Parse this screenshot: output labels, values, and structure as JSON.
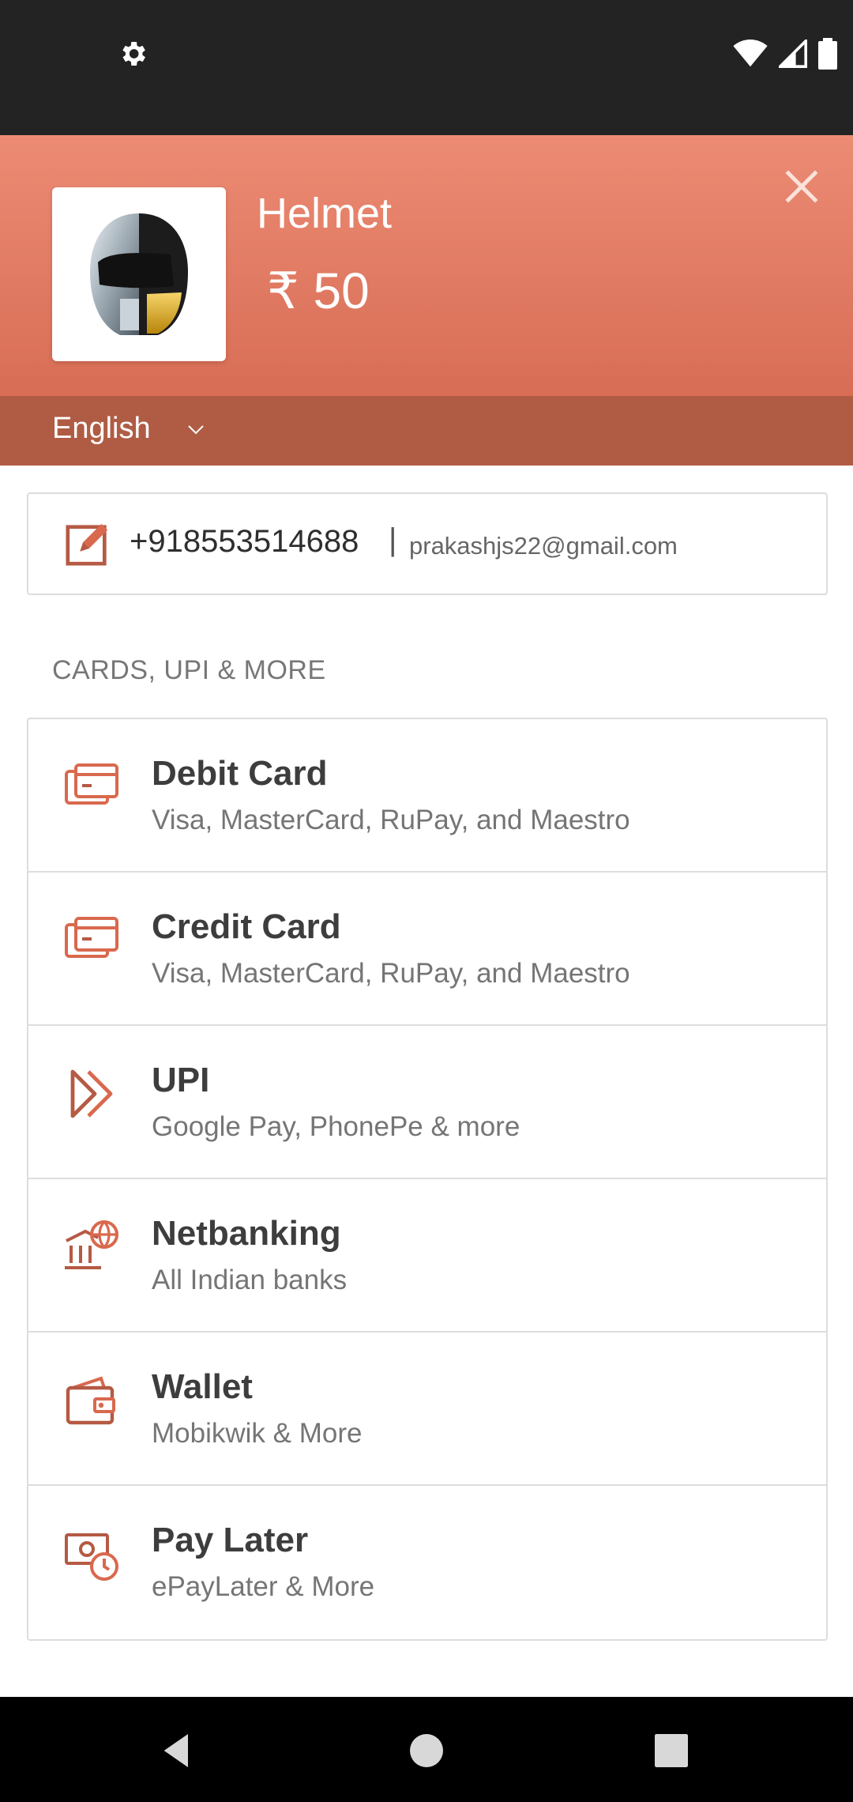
{
  "status_bar": {
    "left_icon": "gear-icon",
    "right_icons": [
      "wifi-icon",
      "signal-icon",
      "battery-icon"
    ]
  },
  "header": {
    "product_name": "Helmet",
    "price": "₹ 50",
    "close_icon": "close-icon",
    "product_image": "helmet-image"
  },
  "language": {
    "selected": "English",
    "icon": "chevron-down-icon"
  },
  "contact": {
    "phone": "+918553514688",
    "separator": "|",
    "email": "prakashjs22@gmail.com",
    "icon": "edit-icon"
  },
  "section": {
    "title": "CARDS, UPI & MORE"
  },
  "methods": [
    {
      "title": "Debit Card",
      "subtitle": "Visa, MasterCard, RuPay, and Maestro",
      "icon": "card-icon"
    },
    {
      "title": "Credit Card",
      "subtitle": "Visa, MasterCard, RuPay, and Maestro",
      "icon": "card-icon"
    },
    {
      "title": "UPI",
      "subtitle": "Google Pay, PhonePe & more",
      "icon": "upi-icon"
    },
    {
      "title": "Netbanking",
      "subtitle": "All Indian banks",
      "icon": "bank-icon"
    },
    {
      "title": "Wallet",
      "subtitle": "Mobikwik & More",
      "icon": "wallet-icon"
    },
    {
      "title": "Pay Later",
      "subtitle": "ePayLater & More",
      "icon": "paylater-icon"
    }
  ],
  "nav_bar": {
    "buttons": [
      "back-icon",
      "home-icon",
      "recents-icon"
    ]
  },
  "colors": {
    "accent": "#d86d55",
    "header_top": "#ec8b74",
    "lang_bar": "#b05c45",
    "icon": "#d9694e"
  }
}
